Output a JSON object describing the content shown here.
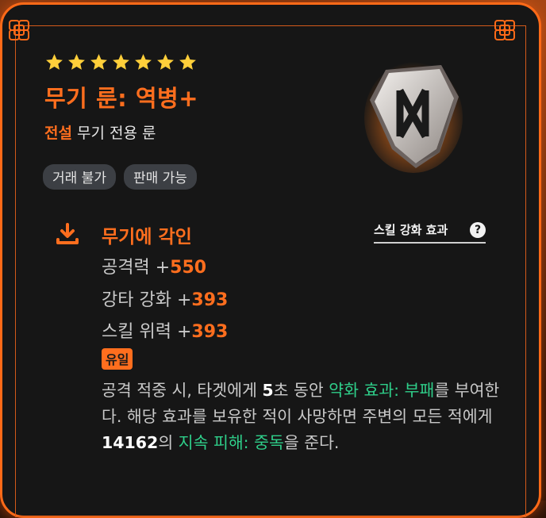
{
  "item": {
    "star_count": 7,
    "title": "무기 룬: 역병+",
    "grade": "전설",
    "type": "무기 전용 룬",
    "tags": [
      "거래 불가",
      "판매 가능"
    ],
    "rune_icon": "rune-stone-icon"
  },
  "section": {
    "icon": "download-icon",
    "title": "무기에 각인",
    "skill_link_label": "스킬 강화 효과",
    "help_icon": "question-mark-icon"
  },
  "stats": [
    {
      "label": "공격력 +",
      "value": "550"
    },
    {
      "label": "강타 강화 +",
      "value": "393"
    },
    {
      "label": "스킬 위력 +",
      "value": "393"
    }
  ],
  "unique_badge": "유일",
  "description": {
    "part1": "공격 적중 시, 타겟에게 ",
    "duration": "5",
    "part2": "초 동안 ",
    "effect1": "약화 효과: 부패",
    "part3": "를 부여한다. 해당 효과를 보유한 적이 사망하면 주변의 모든 적에게 ",
    "damage": "14162",
    "part4": "의 ",
    "effect2": "지속 피해: 중독",
    "part5": "을 준다."
  },
  "colors": {
    "accent": "#ff6e1e",
    "effect": "#2fcf8a",
    "panel": "#161616",
    "star": "#ffcf3a"
  }
}
